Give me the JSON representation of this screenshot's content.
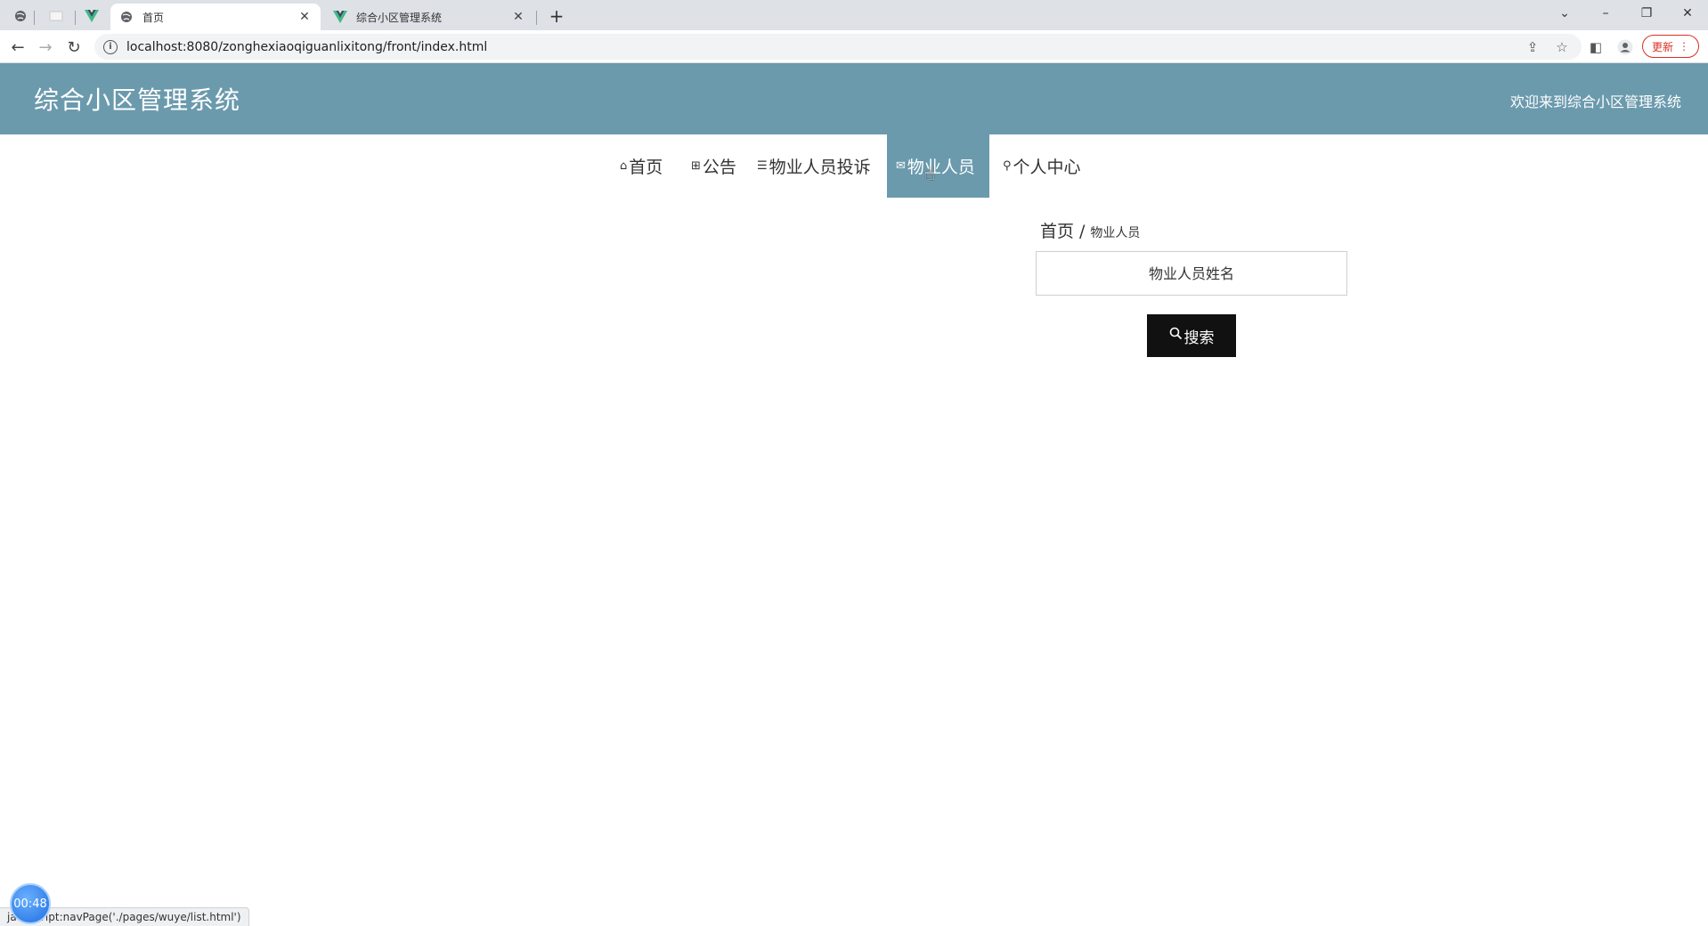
{
  "browser": {
    "tabs": [
      {
        "title": "首页",
        "active": true
      },
      {
        "title": "综合小区管理系统",
        "active": false
      }
    ],
    "url": "localhost:8080/zonghexiaoqiguanlixitong/front/index.html",
    "update_label": "更新",
    "status_text": "javascript:navPage('./pages/wuye/list.html')"
  },
  "header": {
    "title": "综合小区管理系统",
    "welcome": "欢迎来到综合小区管理系统"
  },
  "menu": {
    "items": [
      {
        "label": "首页",
        "icon": "home-icon"
      },
      {
        "label": "公告",
        "icon": "grid-icon"
      },
      {
        "label": "物业人员投诉",
        "icon": "layers-icon"
      },
      {
        "label": "物业人员",
        "icon": "mail-icon",
        "active": true
      },
      {
        "label": "个人中心",
        "icon": "user-icon"
      }
    ]
  },
  "breadcrumb": {
    "home": "首页",
    "separator": "/",
    "current": "物业人员"
  },
  "search": {
    "placeholder": "物业人员姓名",
    "button_label": "搜索"
  },
  "timer": "00:48",
  "colors": {
    "header_bg": "#6b9aad",
    "button_bg": "#111111"
  }
}
